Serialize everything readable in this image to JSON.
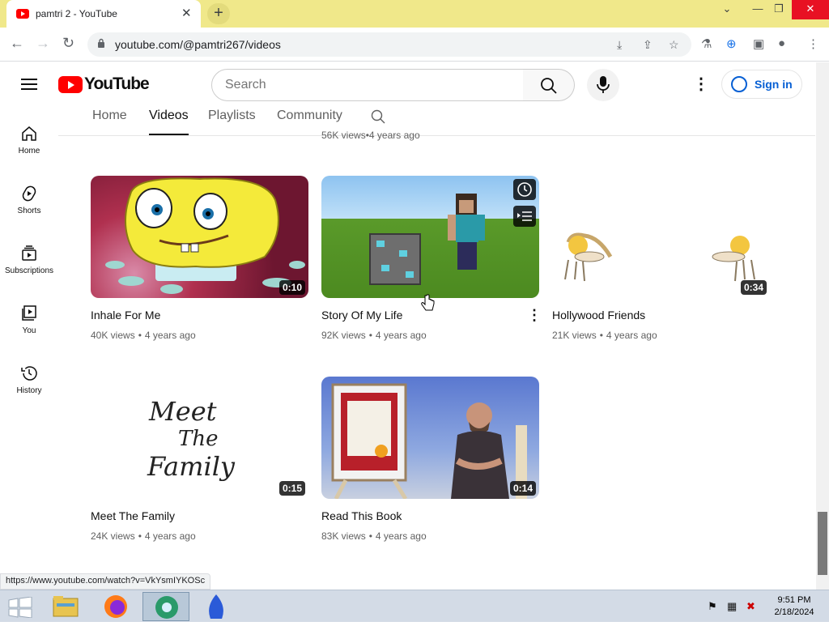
{
  "browser": {
    "tab_title": "pamtri 2 - YouTube",
    "url": "youtube.com/@pamtri267/videos",
    "status_url": "https://www.youtube.com/watch?v=VkYsmIYKOSc"
  },
  "masthead": {
    "logo_text": "YouTube",
    "search_placeholder": "Search",
    "signin_label": "Sign in"
  },
  "channel_tabs": [
    {
      "label": "Home"
    },
    {
      "label": "Videos"
    },
    {
      "label": "Playlists"
    },
    {
      "label": "Community"
    }
  ],
  "sidebar": [
    {
      "label": "Home",
      "icon": "home-icon"
    },
    {
      "label": "Shorts",
      "icon": "shorts-icon"
    },
    {
      "label": "Subscriptions",
      "icon": "subscriptions-icon"
    },
    {
      "label": "You",
      "icon": "library-icon"
    },
    {
      "label": "History",
      "icon": "history-icon"
    }
  ],
  "previous_row_meta": {
    "views": "56K views",
    "age": "4 years ago"
  },
  "videos": [
    {
      "title": "Inhale For Me",
      "duration": "0:10",
      "views": "40K views",
      "age": "4 years ago"
    },
    {
      "title": "Story Of My Life",
      "duration": "",
      "views": "92K views",
      "age": "4 years ago"
    },
    {
      "title": "Hollywood Friends",
      "duration": "0:34",
      "views": "21K views",
      "age": "4 years ago"
    },
    {
      "title": "Meet The Family",
      "duration": "0:15",
      "views": "24K views",
      "age": "4 years ago",
      "thumb_text": [
        "Meet",
        "The",
        "Family"
      ]
    },
    {
      "title": "Read This Book",
      "duration": "0:14",
      "views": "83K views",
      "age": "4 years ago"
    }
  ],
  "taskbar": {
    "time": "9:51 PM",
    "date": "2/18/2024"
  },
  "colors": {
    "youtube_red": "#ff0000",
    "link_blue": "#065fd4",
    "tabstrip": "#f0e88a"
  }
}
